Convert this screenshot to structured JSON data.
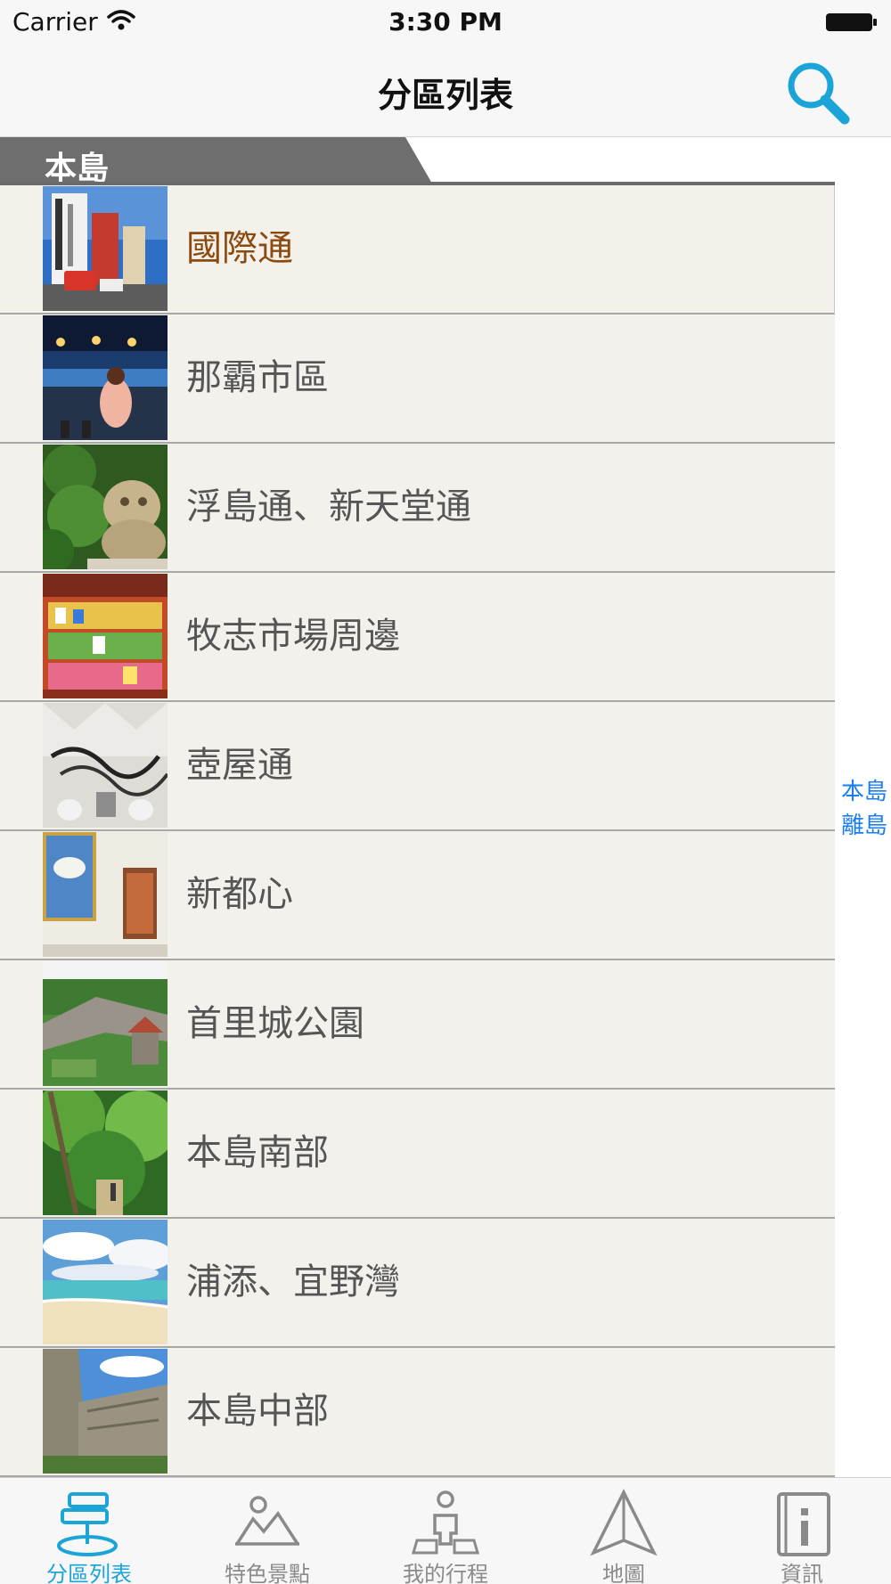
{
  "status_bar": {
    "carrier": "Carrier",
    "time": "3:30 PM"
  },
  "nav": {
    "title": "分區列表",
    "search_icon": "search-icon"
  },
  "section": {
    "title": "本島"
  },
  "items": [
    {
      "label": "國際通",
      "selected": true,
      "icon": "street-photo"
    },
    {
      "label": "那霸市區",
      "selected": false,
      "icon": "market-photo"
    },
    {
      "label": "浮島通、新天堂通",
      "selected": false,
      "icon": "shisa-photo"
    },
    {
      "label": "牧志市場周邊",
      "selected": false,
      "icon": "shop-photo"
    },
    {
      "label": "壺屋通",
      "selected": false,
      "icon": "pottery-photo"
    },
    {
      "label": "新都心",
      "selected": false,
      "icon": "museum-photo"
    },
    {
      "label": "首里城公園",
      "selected": false,
      "icon": "castle-photo"
    },
    {
      "label": "本島南部",
      "selected": false,
      "icon": "forest-photo"
    },
    {
      "label": "浦添、宜野灣",
      "selected": false,
      "icon": "beach-photo"
    },
    {
      "label": "本島中部",
      "selected": false,
      "icon": "ruins-photo"
    }
  ],
  "section_index": [
    "本島",
    "離島"
  ],
  "tabs": [
    {
      "label": "分區列表",
      "icon": "signpost-icon",
      "active": true
    },
    {
      "label": "特色景點",
      "icon": "mountain-icon",
      "active": false
    },
    {
      "label": "我的行程",
      "icon": "person-map-icon",
      "active": false
    },
    {
      "label": "地圖",
      "icon": "compass-icon",
      "active": false
    },
    {
      "label": "資訊",
      "icon": "info-book-icon",
      "active": false
    }
  ],
  "colors": {
    "accent": "#1aa4d8",
    "selected_text": "#8b4a0f",
    "index_link": "#1a7ef2",
    "row_bg": "#f3f1ec"
  }
}
